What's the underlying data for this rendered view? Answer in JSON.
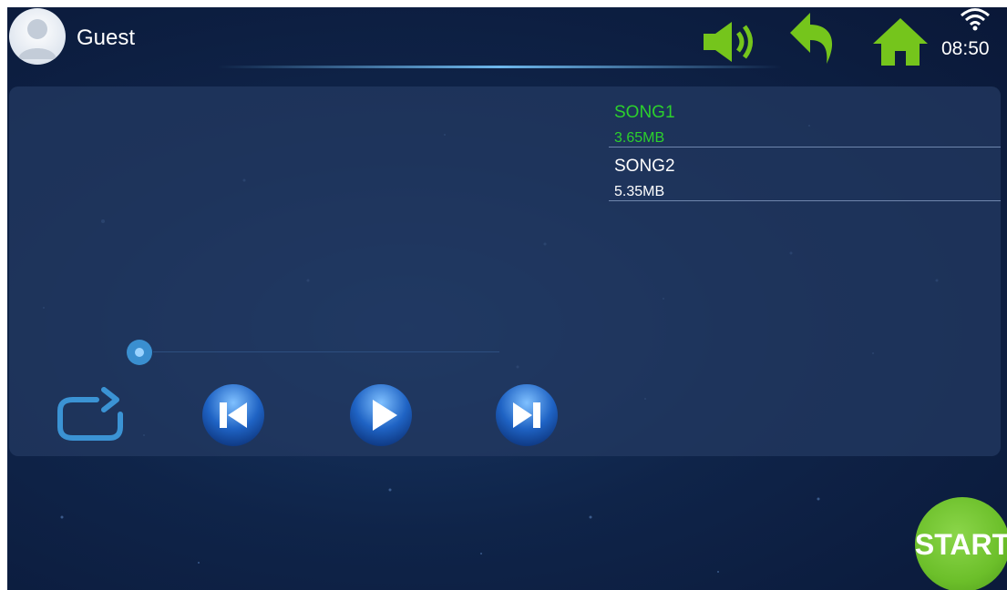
{
  "header": {
    "user_name": "Guest",
    "time": "08:50",
    "icons": {
      "avatar": "user-avatar-icon",
      "volume": "speaker-icon",
      "back": "back-arrow-icon",
      "home": "home-icon",
      "wifi": "wifi-icon"
    },
    "accent_color": "#75c51c"
  },
  "playlist": {
    "items": [
      {
        "name": "SONG1",
        "size": "3.65MB",
        "active": true
      },
      {
        "name": "SONG2",
        "size": "5.35MB",
        "active": false
      }
    ],
    "active_color": "#2cd12c"
  },
  "player": {
    "progress": 0,
    "controls": {
      "repeat": "repeat-icon",
      "previous": "skip-previous-icon",
      "play": "play-icon",
      "next": "skip-next-icon"
    }
  },
  "actions": {
    "start_label": "START",
    "start_color": "#6cbf2a"
  }
}
